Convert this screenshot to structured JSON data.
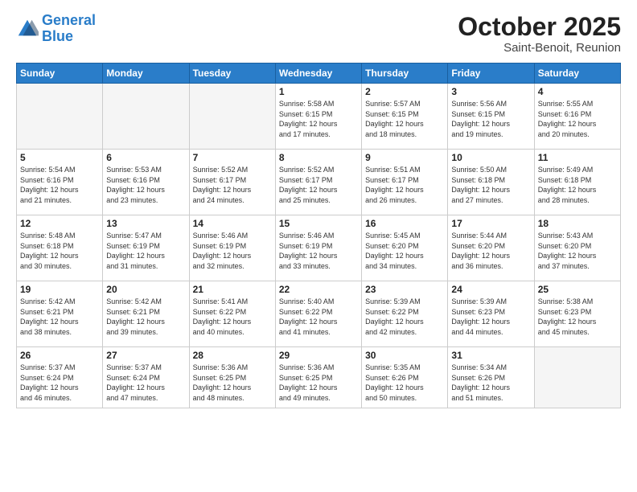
{
  "logo": {
    "line1": "General",
    "line2": "Blue"
  },
  "header": {
    "month": "October 2025",
    "location": "Saint-Benoit, Reunion"
  },
  "days_of_week": [
    "Sunday",
    "Monday",
    "Tuesday",
    "Wednesday",
    "Thursday",
    "Friday",
    "Saturday"
  ],
  "weeks": [
    [
      {
        "day": "",
        "info": ""
      },
      {
        "day": "",
        "info": ""
      },
      {
        "day": "",
        "info": ""
      },
      {
        "day": "1",
        "info": "Sunrise: 5:58 AM\nSunset: 6:15 PM\nDaylight: 12 hours\nand 17 minutes."
      },
      {
        "day": "2",
        "info": "Sunrise: 5:57 AM\nSunset: 6:15 PM\nDaylight: 12 hours\nand 18 minutes."
      },
      {
        "day": "3",
        "info": "Sunrise: 5:56 AM\nSunset: 6:15 PM\nDaylight: 12 hours\nand 19 minutes."
      },
      {
        "day": "4",
        "info": "Sunrise: 5:55 AM\nSunset: 6:16 PM\nDaylight: 12 hours\nand 20 minutes."
      }
    ],
    [
      {
        "day": "5",
        "info": "Sunrise: 5:54 AM\nSunset: 6:16 PM\nDaylight: 12 hours\nand 21 minutes."
      },
      {
        "day": "6",
        "info": "Sunrise: 5:53 AM\nSunset: 6:16 PM\nDaylight: 12 hours\nand 23 minutes."
      },
      {
        "day": "7",
        "info": "Sunrise: 5:52 AM\nSunset: 6:17 PM\nDaylight: 12 hours\nand 24 minutes."
      },
      {
        "day": "8",
        "info": "Sunrise: 5:52 AM\nSunset: 6:17 PM\nDaylight: 12 hours\nand 25 minutes."
      },
      {
        "day": "9",
        "info": "Sunrise: 5:51 AM\nSunset: 6:17 PM\nDaylight: 12 hours\nand 26 minutes."
      },
      {
        "day": "10",
        "info": "Sunrise: 5:50 AM\nSunset: 6:18 PM\nDaylight: 12 hours\nand 27 minutes."
      },
      {
        "day": "11",
        "info": "Sunrise: 5:49 AM\nSunset: 6:18 PM\nDaylight: 12 hours\nand 28 minutes."
      }
    ],
    [
      {
        "day": "12",
        "info": "Sunrise: 5:48 AM\nSunset: 6:18 PM\nDaylight: 12 hours\nand 30 minutes."
      },
      {
        "day": "13",
        "info": "Sunrise: 5:47 AM\nSunset: 6:19 PM\nDaylight: 12 hours\nand 31 minutes."
      },
      {
        "day": "14",
        "info": "Sunrise: 5:46 AM\nSunset: 6:19 PM\nDaylight: 12 hours\nand 32 minutes."
      },
      {
        "day": "15",
        "info": "Sunrise: 5:46 AM\nSunset: 6:19 PM\nDaylight: 12 hours\nand 33 minutes."
      },
      {
        "day": "16",
        "info": "Sunrise: 5:45 AM\nSunset: 6:20 PM\nDaylight: 12 hours\nand 34 minutes."
      },
      {
        "day": "17",
        "info": "Sunrise: 5:44 AM\nSunset: 6:20 PM\nDaylight: 12 hours\nand 36 minutes."
      },
      {
        "day": "18",
        "info": "Sunrise: 5:43 AM\nSunset: 6:20 PM\nDaylight: 12 hours\nand 37 minutes."
      }
    ],
    [
      {
        "day": "19",
        "info": "Sunrise: 5:42 AM\nSunset: 6:21 PM\nDaylight: 12 hours\nand 38 minutes."
      },
      {
        "day": "20",
        "info": "Sunrise: 5:42 AM\nSunset: 6:21 PM\nDaylight: 12 hours\nand 39 minutes."
      },
      {
        "day": "21",
        "info": "Sunrise: 5:41 AM\nSunset: 6:22 PM\nDaylight: 12 hours\nand 40 minutes."
      },
      {
        "day": "22",
        "info": "Sunrise: 5:40 AM\nSunset: 6:22 PM\nDaylight: 12 hours\nand 41 minutes."
      },
      {
        "day": "23",
        "info": "Sunrise: 5:39 AM\nSunset: 6:22 PM\nDaylight: 12 hours\nand 42 minutes."
      },
      {
        "day": "24",
        "info": "Sunrise: 5:39 AM\nSunset: 6:23 PM\nDaylight: 12 hours\nand 44 minutes."
      },
      {
        "day": "25",
        "info": "Sunrise: 5:38 AM\nSunset: 6:23 PM\nDaylight: 12 hours\nand 45 minutes."
      }
    ],
    [
      {
        "day": "26",
        "info": "Sunrise: 5:37 AM\nSunset: 6:24 PM\nDaylight: 12 hours\nand 46 minutes."
      },
      {
        "day": "27",
        "info": "Sunrise: 5:37 AM\nSunset: 6:24 PM\nDaylight: 12 hours\nand 47 minutes."
      },
      {
        "day": "28",
        "info": "Sunrise: 5:36 AM\nSunset: 6:25 PM\nDaylight: 12 hours\nand 48 minutes."
      },
      {
        "day": "29",
        "info": "Sunrise: 5:36 AM\nSunset: 6:25 PM\nDaylight: 12 hours\nand 49 minutes."
      },
      {
        "day": "30",
        "info": "Sunrise: 5:35 AM\nSunset: 6:26 PM\nDaylight: 12 hours\nand 50 minutes."
      },
      {
        "day": "31",
        "info": "Sunrise: 5:34 AM\nSunset: 6:26 PM\nDaylight: 12 hours\nand 51 minutes."
      },
      {
        "day": "",
        "info": ""
      }
    ]
  ]
}
